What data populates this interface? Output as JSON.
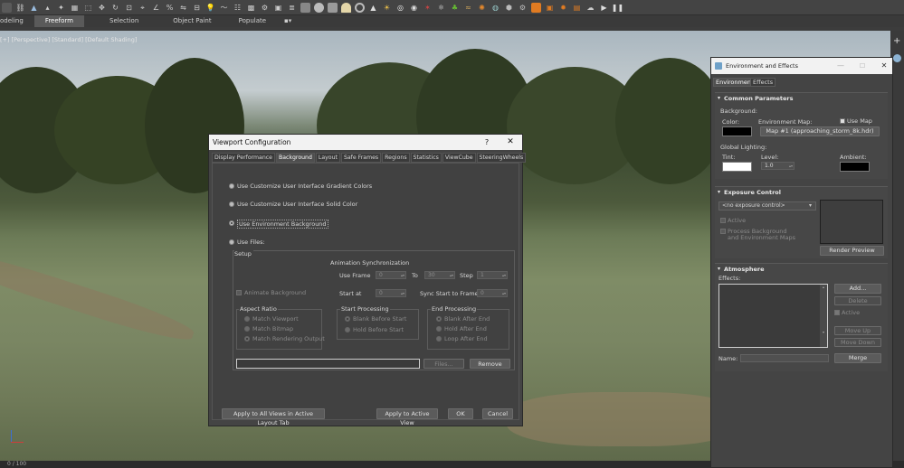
{
  "ribbon": {
    "tabs": [
      {
        "label": "odeling",
        "active": false
      },
      {
        "label": "Freeform",
        "active": true
      },
      {
        "label": "Selection",
        "active": false
      },
      {
        "label": "Object Paint",
        "active": false
      },
      {
        "label": "Populate",
        "active": false
      }
    ]
  },
  "viewport": {
    "label": "[+] [Perspective] [Standard] [Default Shading]",
    "status_text": "0 / 100"
  },
  "viewport_config": {
    "title": "Viewport Configuration",
    "help": "?",
    "close": "✕",
    "tabs": [
      "Display Performance",
      "Background",
      "Layout",
      "Safe Frames",
      "Regions",
      "Statistics",
      "ViewCube",
      "SteeringWheels"
    ],
    "active_tab": "Background",
    "options": {
      "gradient": "Use Customize User Interface Gradient Colors",
      "solid": "Use Customize User Interface Solid Color",
      "environment": "Use Environment Background",
      "files": "Use Files:"
    },
    "setup": {
      "label": "Setup",
      "animate_bg": "Animate Background",
      "anim_sync": "Animation Synchronization",
      "use_frame": "Use Frame",
      "use_frame_value": "0",
      "to": "To",
      "to_value": "30",
      "step": "Step",
      "step_value": "1",
      "start_at": "Start at",
      "start_at_value": "0",
      "sync_start": "Sync Start to Frame",
      "sync_start_value": "0",
      "aspect_ratio": {
        "label": "Aspect Ratio",
        "items": [
          "Match Viewport",
          "Match Bitmap",
          "Match Rendering Output"
        ]
      },
      "start_processing": {
        "label": "Start Processing",
        "items": [
          "Blank Before Start",
          "Hold Before Start"
        ]
      },
      "end_processing": {
        "label": "End Processing",
        "items": [
          "Blank After End",
          "Hold After End",
          "Loop After End"
        ]
      },
      "file_path": "",
      "files_button": "Files...",
      "remove_button": "Remove"
    },
    "buttons": {
      "apply_all": "Apply to All Views in Active Layout Tab",
      "apply_active": "Apply to Active View",
      "ok": "OK",
      "cancel": "Cancel"
    }
  },
  "env_effects": {
    "title": "Environment and Effects",
    "tabs": [
      "Environment",
      "Effects"
    ],
    "common": {
      "header": "Common Parameters",
      "background": "Background:",
      "color": "Color:",
      "env_map": "Environment Map:",
      "use_map": "Use Map",
      "map_name": "Map #1 (approaching_storm_8k.hdr)",
      "global_lighting": "Global Lighting:",
      "tint": "Tint:",
      "level": "Level:",
      "level_value": "1.0",
      "ambient": "Ambient:"
    },
    "exposure": {
      "header": "Exposure Control",
      "dropdown": "<no exposure control>",
      "active": "Active",
      "process_bg": "Process Background",
      "process_bg2": "and Environment Maps",
      "render_preview": "Render Preview"
    },
    "atmosphere": {
      "header": "Atmosphere",
      "effects": "Effects:",
      "add": "Add...",
      "delete": "Delete",
      "active": "Active",
      "move_up": "Move Up",
      "move_down": "Move Down",
      "name": "Name:",
      "merge": "Merge"
    }
  },
  "colors": {
    "background_color": "#000000",
    "tint_color": "#ffffff",
    "ambient_color": "#000000",
    "accent_orange": "#e07b22"
  }
}
